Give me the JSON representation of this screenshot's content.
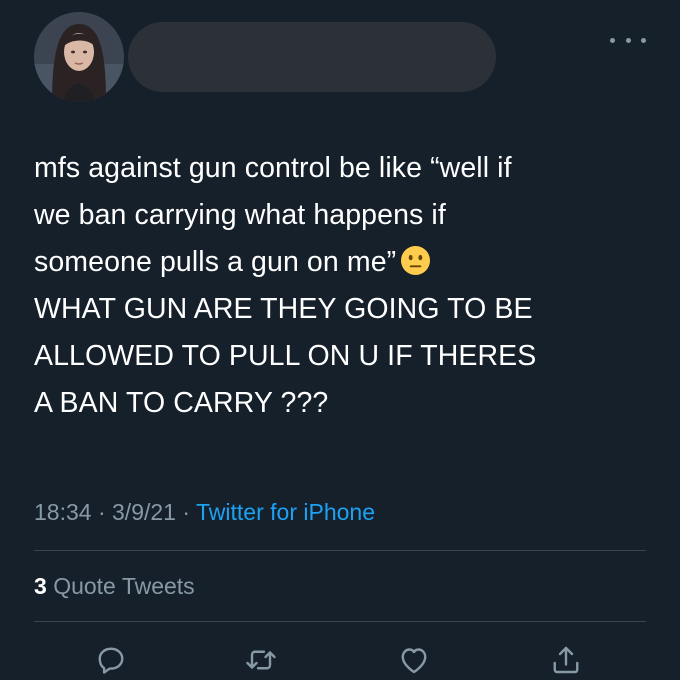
{
  "tweet": {
    "line1": "mfs against gun control be like “well if",
    "line2": "we ban carrying what happens if",
    "line3": "someone pulls a gun on me”",
    "line4": "WHAT GUN ARE THEY GOING TO BE",
    "line5": "ALLOWED TO PULL ON U IF THERES",
    "line6": "A BAN TO CARRY ???",
    "emoji": "neutral-face-emoji"
  },
  "meta": {
    "time": "18:34",
    "separator": "·",
    "date": "3/9/21",
    "source": "Twitter for iPhone"
  },
  "quotes": {
    "count": "3",
    "label": "Quote Tweets"
  },
  "icons": {
    "more": "more-icon",
    "reply": "reply-icon",
    "retweet": "retweet-icon",
    "like": "like-icon",
    "share": "share-icon"
  },
  "colors": {
    "background": "#15202b",
    "text": "#ffffff",
    "muted": "#8899a6",
    "link": "#1da1f2",
    "divider": "#38444d"
  }
}
